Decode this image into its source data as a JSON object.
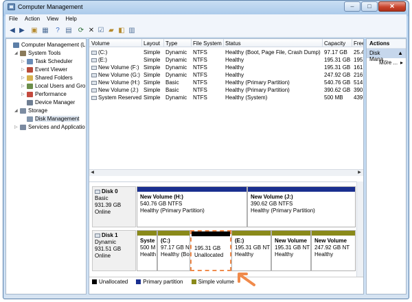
{
  "window": {
    "title": "Computer Management"
  },
  "menu": [
    "File",
    "Action",
    "View",
    "Help"
  ],
  "tree": [
    {
      "label": "Computer Management (L",
      "indent": 0,
      "expand": "",
      "icon": "#5d7fa7"
    },
    {
      "label": "System Tools",
      "indent": 1,
      "expand": "◢",
      "icon": "#8a7a5a"
    },
    {
      "label": "Task Scheduler",
      "indent": 2,
      "expand": "▷",
      "icon": "#6a8cb7"
    },
    {
      "label": "Event Viewer",
      "indent": 2,
      "expand": "▷",
      "icon": "#b84b3a"
    },
    {
      "label": "Shared Folders",
      "indent": 2,
      "expand": "▷",
      "icon": "#d6b24e"
    },
    {
      "label": "Local Users and Gro",
      "indent": 2,
      "expand": "▷",
      "icon": "#6b8e4a"
    },
    {
      "label": "Performance",
      "indent": 2,
      "expand": "▷",
      "icon": "#c44a3e"
    },
    {
      "label": "Device Manager",
      "indent": 2,
      "expand": "",
      "icon": "#6f7e92"
    },
    {
      "label": "Storage",
      "indent": 1,
      "expand": "◢",
      "icon": "#7d8da2"
    },
    {
      "label": "Disk Management",
      "indent": 2,
      "expand": "",
      "icon": "#8396ad",
      "selected": true
    },
    {
      "label": "Services and Applicatio",
      "indent": 1,
      "expand": "▷",
      "icon": "#7b8aa0"
    }
  ],
  "volume_table": {
    "headers": [
      "Volume",
      "Layout",
      "Type",
      "File System",
      "Status",
      "Capacity",
      "Free"
    ],
    "rows": [
      [
        "(C:)",
        "Simple",
        "Dynamic",
        "NTFS",
        "Healthy (Boot, Page File, Crash Dump)",
        "97.17 GB",
        "25.4"
      ],
      [
        "(E:)",
        "Simple",
        "Dynamic",
        "NTFS",
        "Healthy",
        "195.31 GB",
        "195."
      ],
      [
        "New Volume (F:)",
        "Simple",
        "Dynamic",
        "NTFS",
        "Healthy",
        "195.31 GB",
        "161."
      ],
      [
        "New Volume (G:)",
        "Simple",
        "Dynamic",
        "NTFS",
        "Healthy",
        "247.92 GB",
        "216."
      ],
      [
        "New Volume (H:)",
        "Simple",
        "Basic",
        "NTFS",
        "Healthy (Primary Partition)",
        "540.76 GB",
        "514."
      ],
      [
        "New Volume (J:)",
        "Simple",
        "Basic",
        "NTFS",
        "Healthy (Primary Partition)",
        "390.62 GB",
        "390."
      ],
      [
        "System Reserved",
        "Simple",
        "Dynamic",
        "NTFS",
        "Healthy (System)",
        "500 MB",
        "439"
      ]
    ]
  },
  "disks": [
    {
      "name": "Disk 0",
      "type": "Basic",
      "size": "931.39 GB",
      "status": "Online",
      "partitions": [
        {
          "name": "New Volume  (H:)",
          "line2": "540.76 GB NTFS",
          "line3": "Healthy (Primary Partition)",
          "kind": "primary"
        },
        {
          "name": "New Volume  (J:)",
          "line2": "390.62 GB NTFS",
          "line3": "Healthy (Primary Partition)",
          "kind": "primary"
        }
      ]
    },
    {
      "name": "Disk 1",
      "type": "Dynamic",
      "size": "931.51 GB",
      "status": "Online",
      "partitions": [
        {
          "name": "Syste",
          "line2": "500 M",
          "line3": "Health",
          "kind": "simple"
        },
        {
          "name": "(C:)",
          "line2": "97.17 GB NTF",
          "line3": "Healthy (Boo",
          "kind": "simple"
        },
        {
          "name": "",
          "line2": "195.31 GB",
          "line3": "Unallocated",
          "kind": "unallocated",
          "selected": true
        },
        {
          "name": "(E:)",
          "line2": "195.31 GB NT",
          "line3": "Healthy",
          "kind": "simple"
        },
        {
          "name": "New Volume",
          "line2": "195.31 GB NT",
          "line3": "Healthy",
          "kind": "simple"
        },
        {
          "name": "New Volume",
          "line2": "247.92 GB NT",
          "line3": "Healthy",
          "kind": "simple"
        }
      ]
    }
  ],
  "legend": [
    {
      "label": "Unallocated",
      "color": "#000000"
    },
    {
      "label": "Primary partition",
      "color": "#1a2f8f"
    },
    {
      "label": "Simple volume",
      "color": "#8a8a1a"
    }
  ],
  "actions": {
    "header": "Actions",
    "selected": "Disk Mana...",
    "more": "More ..."
  },
  "colors": {
    "primary": "#1a2f8f",
    "simple": "#8a8a1a",
    "unallocated": "#000000",
    "callout": "#f08a4b"
  }
}
